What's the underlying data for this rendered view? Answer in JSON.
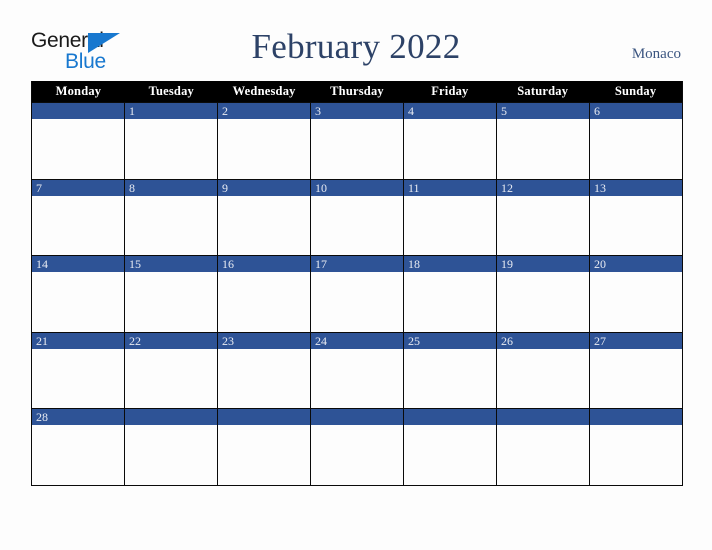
{
  "brand": {
    "logo_text_primary": "General",
    "logo_text_secondary": "Blue",
    "logo_triangle_icon": "triangle-icon",
    "primary_color": "#1878cf",
    "text_color": "#1a1a1a"
  },
  "header": {
    "title": "February 2022",
    "month": "February",
    "year": "2022",
    "location": "Monaco",
    "title_color": "#2d4267",
    "location_color": "#3b5580"
  },
  "calendar": {
    "accent_color": "#2e5396",
    "header_background": "#000000",
    "header_text_color": "#ffffff",
    "grid_line_color": "#0a0a0a",
    "cell_background": "#fdfdfd",
    "weekdays": [
      "Monday",
      "Tuesday",
      "Wednesday",
      "Thursday",
      "Friday",
      "Saturday",
      "Sunday"
    ],
    "weeks": [
      [
        "",
        "1",
        "2",
        "3",
        "4",
        "5",
        "6"
      ],
      [
        "7",
        "8",
        "9",
        "10",
        "11",
        "12",
        "13"
      ],
      [
        "14",
        "15",
        "16",
        "17",
        "18",
        "19",
        "20"
      ],
      [
        "21",
        "22",
        "23",
        "24",
        "25",
        "26",
        "27"
      ],
      [
        "28",
        "",
        "",
        "",
        "",
        "",
        ""
      ]
    ]
  }
}
